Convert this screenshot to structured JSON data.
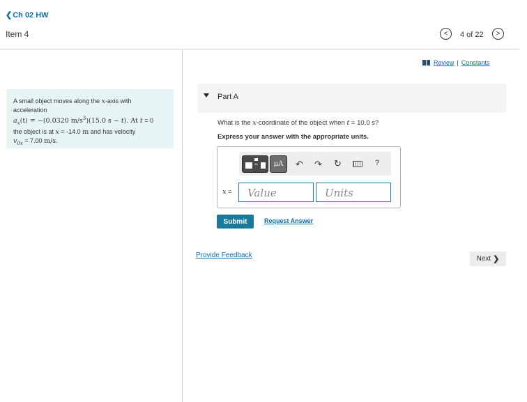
{
  "header": {
    "back_label": "Ch 02 HW",
    "item_title": "Item 4",
    "pager": "4 of 22"
  },
  "problem": {
    "line1": "A small object moves along the ",
    "line1_var": "x",
    "line1_end": "-axis with",
    "line2": "acceleration",
    "line3_math": "a",
    "line3_sub": "x",
    "line3_expr": "(t) = −(0.0320 m/s",
    "line3_sup": "3",
    "line3_expr2": ")(15.0 s − ",
    "line3_t": "t",
    "line3_expr3": "). At ",
    "line3_t2": "t",
    "line3_end": " = 0",
    "line4_a": "the object is at ",
    "line4_x": "x",
    "line4_b": " = -14.0 ",
    "line4_unit": "m",
    "line4_c": " and has velocity",
    "line5_v": "v",
    "line5_sub": "0x",
    "line5_b": " = 7.00 ",
    "line5_unit": "m/s",
    "line5_end": "."
  },
  "links": {
    "review": "Review",
    "separator": " | ",
    "constants": "Constants"
  },
  "part_a": {
    "title": "Part A",
    "question_a": "What is the ",
    "question_x": "x",
    "question_b": "-coordinate of the object when ",
    "question_t": "t",
    "question_c": " = 10.0 s?",
    "instruction": "Express your answer with the appropriate units.",
    "toolbar": {
      "mu_label": "μA",
      "undo_icon": "↶",
      "redo_icon": "↷",
      "reset_icon": "↻",
      "help_label": "?"
    },
    "answer_var": "x",
    "answer_eq": " =",
    "value_placeholder": "Value",
    "units_placeholder": "Units",
    "submit_label": "Submit",
    "request_answer": "Request Answer"
  },
  "footer": {
    "feedback": "Provide Feedback",
    "next_label": "Next"
  },
  "icons": {
    "back": "chevron-left-icon",
    "prev": "chevron-left-icon",
    "next": "chevron-right-icon",
    "review": "book-icon",
    "caret": "caret-down-icon",
    "templates": "templates-icon",
    "greek": "mu-icon",
    "undo": "undo-icon",
    "redo": "redo-icon",
    "reset": "reset-icon",
    "keyboard": "keyboard-icon",
    "help": "help-icon"
  },
  "colors": {
    "link": "#0b6ea8",
    "accent": "#1a7a9b",
    "problem_bg": "#e6f4f6",
    "panel_bg": "#f5f5f5"
  }
}
